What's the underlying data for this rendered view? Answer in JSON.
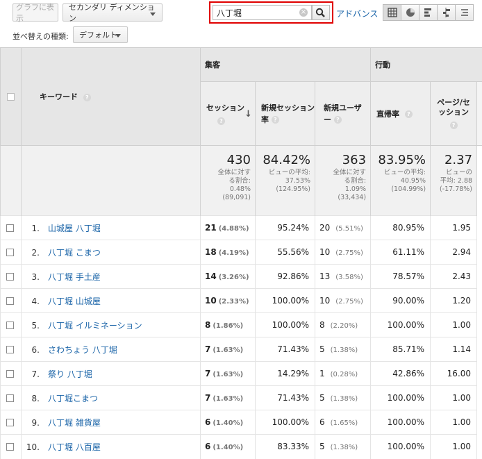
{
  "toolbar": {
    "graph_btn": "グラフに表示",
    "secondary_dim": "セカンダリ ディメンション",
    "search_value": "八丁堀",
    "advanced": "アドバンス",
    "sort_label": "並べ替えの種類:",
    "sort_value": "デフォルト",
    "view_icons": [
      "table-view-icon",
      "pie-view-icon",
      "performance-view-icon",
      "comparison-view-icon",
      "pivot-view-icon"
    ]
  },
  "header": {
    "keyword": "キーワード",
    "group_acquisition": "集客",
    "group_behavior": "行動",
    "col_sessions": "セッション",
    "col_new_session_rate": "新規セッション率",
    "col_new_users": "新規ユーザー",
    "col_bounce": "直帰率",
    "col_pages_session": "ページ/セッション"
  },
  "totals": {
    "sessions": {
      "value": "430",
      "l1": "全体に対す",
      "l2": "る割合:",
      "l3": "0.48%",
      "l4": "(89,091)"
    },
    "new_session_rate": {
      "value": "84.42%",
      "l1": "ビューの平均:",
      "l2": "37.53%",
      "l3": "(124.95%)"
    },
    "new_users": {
      "value": "363",
      "l1": "全体に対す",
      "l2": "る割合:",
      "l3": "1.09%",
      "l4": "(33,434)"
    },
    "bounce": {
      "value": "83.95%",
      "l1": "ビューの平均:",
      "l2": "40.95%",
      "l3": "(104.99%)"
    },
    "pages": {
      "value": "2.37",
      "l1": "ビューの",
      "l2": "平均: 2.88",
      "l3": "(-17.78%)"
    }
  },
  "rows": [
    {
      "idx": "1.",
      "kw": "山城屋 八丁堀",
      "sess": "21",
      "sess_pct": "(4.88%)",
      "nsr": "95.24%",
      "nu": "20",
      "nu_pct": "(5.51%)",
      "br": "80.95%",
      "pps": "1.95"
    },
    {
      "idx": "2.",
      "kw": "八丁堀 こまつ",
      "sess": "18",
      "sess_pct": "(4.19%)",
      "nsr": "55.56%",
      "nu": "10",
      "nu_pct": "(2.75%)",
      "br": "61.11%",
      "pps": "2.94"
    },
    {
      "idx": "3.",
      "kw": "八丁堀 手土産",
      "sess": "14",
      "sess_pct": "(3.26%)",
      "nsr": "92.86%",
      "nu": "13",
      "nu_pct": "(3.58%)",
      "br": "78.57%",
      "pps": "2.43"
    },
    {
      "idx": "4.",
      "kw": "八丁堀 山城屋",
      "sess": "10",
      "sess_pct": "(2.33%)",
      "nsr": "100.00%",
      "nu": "10",
      "nu_pct": "(2.75%)",
      "br": "90.00%",
      "pps": "1.20"
    },
    {
      "idx": "5.",
      "kw": "八丁堀 イルミネーション",
      "sess": "8",
      "sess_pct": "(1.86%)",
      "nsr": "100.00%",
      "nu": "8",
      "nu_pct": "(2.20%)",
      "br": "100.00%",
      "pps": "1.00"
    },
    {
      "idx": "6.",
      "kw": "さわちょう 八丁堀",
      "sess": "7",
      "sess_pct": "(1.63%)",
      "nsr": "71.43%",
      "nu": "5",
      "nu_pct": "(1.38%)",
      "br": "85.71%",
      "pps": "1.14"
    },
    {
      "idx": "7.",
      "kw": "祭り 八丁堀",
      "sess": "7",
      "sess_pct": "(1.63%)",
      "nsr": "14.29%",
      "nu": "1",
      "nu_pct": "(0.28%)",
      "br": "42.86%",
      "pps": "16.00"
    },
    {
      "idx": "8.",
      "kw": "八丁堀こまつ",
      "sess": "7",
      "sess_pct": "(1.63%)",
      "nsr": "71.43%",
      "nu": "5",
      "nu_pct": "(1.38%)",
      "br": "100.00%",
      "pps": "1.00"
    },
    {
      "idx": "9.",
      "kw": "八丁堀 雑貨屋",
      "sess": "6",
      "sess_pct": "(1.40%)",
      "nsr": "100.00%",
      "nu": "6",
      "nu_pct": "(1.65%)",
      "br": "100.00%",
      "pps": "1.00"
    },
    {
      "idx": "10.",
      "kw": "八丁堀 八百屋",
      "sess": "6",
      "sess_pct": "(1.40%)",
      "nsr": "83.33%",
      "nu": "5",
      "nu_pct": "(1.38%)",
      "br": "100.00%",
      "pps": "1.00"
    }
  ]
}
